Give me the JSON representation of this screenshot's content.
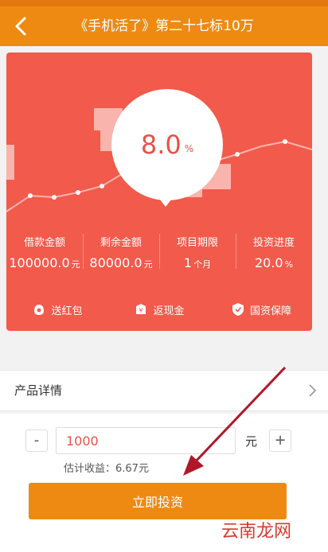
{
  "nav": {
    "title": "《手机活了》第二十七标10万"
  },
  "rate": {
    "value": "8.0",
    "unit": "%"
  },
  "stats": [
    {
      "label": "借款金额",
      "value": "100000.0",
      "unit": "元"
    },
    {
      "label": "剩余金额",
      "value": "80000.0",
      "unit": "元"
    },
    {
      "label": "项目期限",
      "value": "1",
      "unit": "个月"
    },
    {
      "label": "投资进度",
      "value": "20.0",
      "unit": "%"
    }
  ],
  "perks": [
    {
      "label": "送红包",
      "icon": "red-envelope-icon"
    },
    {
      "label": "返现金",
      "icon": "cashback-icon"
    },
    {
      "label": "国资保障",
      "icon": "shield-icon"
    }
  ],
  "detail": {
    "label": "产品详情"
  },
  "invest": {
    "minus": "-",
    "plus": "+",
    "amount": "1000",
    "unit": "元",
    "estimate": "估计收益：6.67元",
    "button": "立即投资"
  },
  "watermark": "云南龙网",
  "colors": {
    "accent": "#ee8a12",
    "card": "#f25a4b",
    "rate": "#e5534a"
  }
}
